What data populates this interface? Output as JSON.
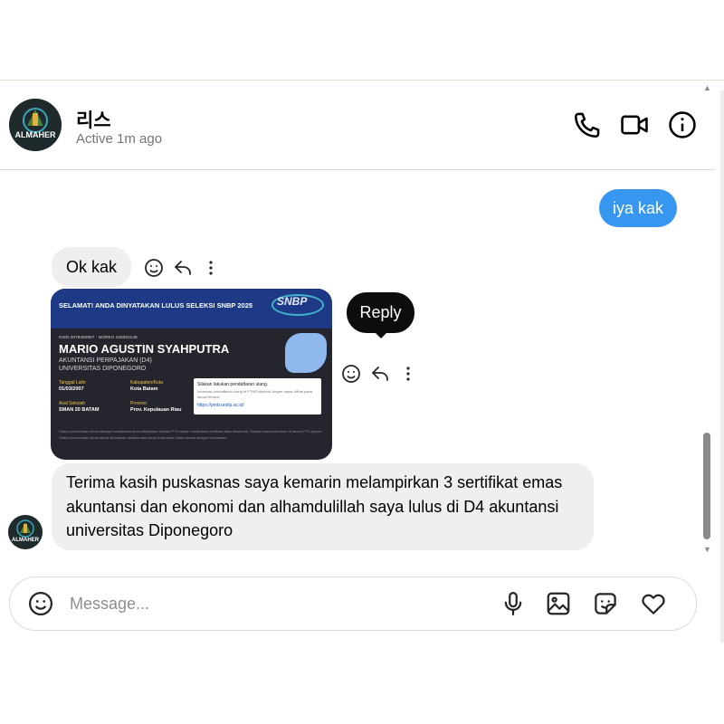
{
  "header": {
    "name": "리스",
    "status": "Active 1m ago",
    "avatar_text": "ALMAHER",
    "icons": [
      "phone-icon",
      "video-icon",
      "info-icon"
    ]
  },
  "messages": {
    "outgoing_1": "iya kak",
    "incoming_1": "Ok kak",
    "incoming_2": "Terima kasih puskasnas saya kemarin melampirkan 3 sertifikat emas akuntansi dan ekonomi dan alhamdulillah saya lulus di D4 akuntansi universitas Diponegoro"
  },
  "certificate": {
    "headline": "SELAMAT! ANDA DINYATAKAN LULUS SELEKSI SNBP 2025",
    "logo": "SNBP",
    "ids": "NISN 0078460857 · NOREG 425062148",
    "name": "MARIO AGUSTIN SYAHPUTRA",
    "program": "AKUNTANSI PERPAJAKAN (D4)",
    "university": "UNIVERSITAS DIPONEGORO",
    "birth_label": "Tanggal Lahir",
    "birth_value": "01/03/2007",
    "city_label": "Kabupaten/Kota",
    "city_value": "Kota Batam",
    "school_label": "Asal Sekolah",
    "school_value": "SMAN 20 BATAM",
    "province_label": "Provinsi",
    "province_value": "Prov. Kepulauan Riau",
    "box_text": "Silakan lakukan pendaftaran ulang.",
    "box_sub": "Informasi pendaftaran ulang di PTN/Politeknik Negeri dapat dilihat pada laman berikut:",
    "box_url": "https://pmb.undip.ac.id/",
    "footer": "Status penerimaan Anda sebagai mahasiswa akan ditetapkan setelah PTN tujuan melakukan verifikasi data akademik. Silakan baca ketentuan di laman PTN tujuan. Status penerimaan Anda dapat dibatalkan apabila data yang Anda isikan tidak sesuai dengan kenyataan."
  },
  "tooltip": {
    "label": "Reply"
  },
  "composer": {
    "placeholder": "Message...",
    "icons": [
      "emoji-icon",
      "microphone-icon",
      "image-icon",
      "sticker-icon",
      "heart-icon"
    ]
  }
}
